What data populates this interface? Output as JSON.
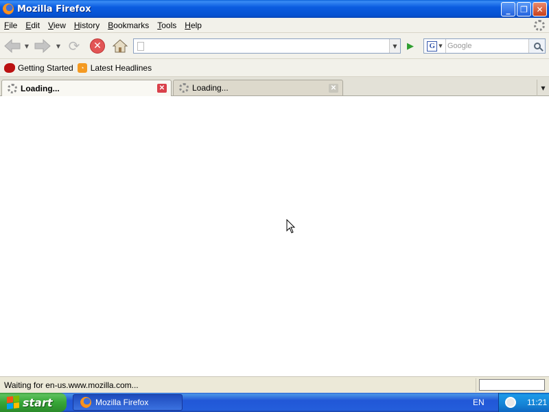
{
  "window": {
    "title": "Mozilla Firefox"
  },
  "menu": [
    "File",
    "Edit",
    "View",
    "History",
    "Bookmarks",
    "Tools",
    "Help"
  ],
  "nav": {
    "url_value": "",
    "search_engine": "G",
    "search_placeholder": "Google"
  },
  "bookmarks": [
    {
      "label": "Getting Started",
      "icon": "firefox-icon"
    },
    {
      "label": "Latest Headlines",
      "icon": "rss-icon"
    }
  ],
  "tabs": [
    {
      "label": "Loading...",
      "active": true
    },
    {
      "label": "Loading...",
      "active": false
    }
  ],
  "status": {
    "text": "Waiting for en-us.www.mozilla.com..."
  },
  "taskbar": {
    "start_label": "start",
    "task_label": "Mozilla Firefox",
    "language": "EN",
    "clock": "11:21"
  },
  "colors": {
    "titlebar": "#0b5ce0",
    "start_button": "#37a637",
    "tab_close_active": "#d9414b"
  }
}
